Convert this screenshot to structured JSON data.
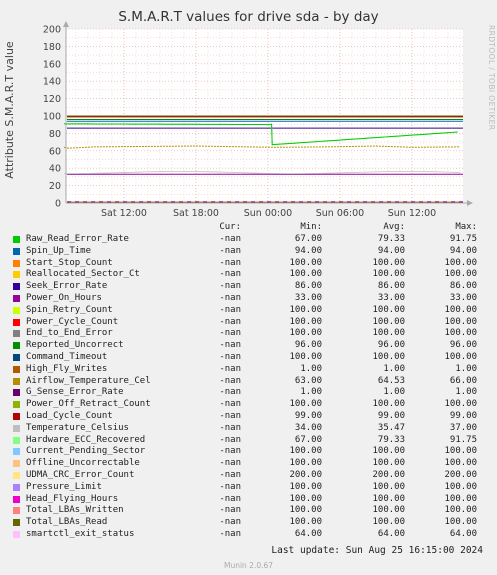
{
  "chart_data": {
    "type": "line",
    "title": "S.M.A.R.T values for drive sda - by day",
    "ylabel": "Attribute S.M.A.R.T value",
    "ylim": [
      0,
      200
    ],
    "yticks": [
      0,
      20,
      40,
      60,
      80,
      100,
      120,
      140,
      160,
      180,
      200
    ],
    "xticks": [
      "Sat 12:00",
      "Sat 18:00",
      "Sun 00:00",
      "Sun 06:00",
      "Sun 12:00"
    ],
    "grid": true,
    "watermark": "RRDTOOL / TOBI OETIKER",
    "columns": [
      "Cur:",
      "Min:",
      "Avg:",
      "Max:"
    ],
    "series": [
      {
        "name": "Raw_Read_Error_Rate",
        "color": "#00cc00",
        "cur": "-nan",
        "min": "67.00",
        "avg": "79.33",
        "max": "91.75"
      },
      {
        "name": "Spin_Up_Time",
        "color": "#0066b3",
        "cur": "-nan",
        "min": "94.00",
        "avg": "94.00",
        "max": "94.00"
      },
      {
        "name": "Start_Stop_Count",
        "color": "#ff8000",
        "cur": "-nan",
        "min": "100.00",
        "avg": "100.00",
        "max": "100.00"
      },
      {
        "name": "Reallocated_Sector_Ct",
        "color": "#ffcc00",
        "cur": "-nan",
        "min": "100.00",
        "avg": "100.00",
        "max": "100.00"
      },
      {
        "name": "Seek_Error_Rate",
        "color": "#330099",
        "cur": "-nan",
        "min": "86.00",
        "avg": "86.00",
        "max": "86.00"
      },
      {
        "name": "Power_On_Hours",
        "color": "#990099",
        "cur": "-nan",
        "min": "33.00",
        "avg": "33.00",
        "max": "33.00"
      },
      {
        "name": "Spin_Retry_Count",
        "color": "#ccff00",
        "cur": "-nan",
        "min": "100.00",
        "avg": "100.00",
        "max": "100.00"
      },
      {
        "name": "Power_Cycle_Count",
        "color": "#ff0000",
        "cur": "-nan",
        "min": "100.00",
        "avg": "100.00",
        "max": "100.00"
      },
      {
        "name": "End_to_End_Error",
        "color": "#808080",
        "cur": "-nan",
        "min": "100.00",
        "avg": "100.00",
        "max": "100.00"
      },
      {
        "name": "Reported_Uncorrect",
        "color": "#008f00",
        "cur": "-nan",
        "min": "96.00",
        "avg": "96.00",
        "max": "96.00"
      },
      {
        "name": "Command_Timeout",
        "color": "#00487d",
        "cur": "-nan",
        "min": "100.00",
        "avg": "100.00",
        "max": "100.00"
      },
      {
        "name": "High_Fly_Writes",
        "color": "#b35a00",
        "cur": "-nan",
        "min": "1.00",
        "avg": "1.00",
        "max": "1.00"
      },
      {
        "name": "Airflow_Temperature_Cel",
        "color": "#b38f00",
        "cur": "-nan",
        "min": "63.00",
        "avg": "64.53",
        "max": "66.00"
      },
      {
        "name": "G_Sense_Error_Rate",
        "color": "#6b006b",
        "cur": "-nan",
        "min": "1.00",
        "avg": "1.00",
        "max": "1.00"
      },
      {
        "name": "Power_Off_Retract_Count",
        "color": "#8fb300",
        "cur": "-nan",
        "min": "100.00",
        "avg": "100.00",
        "max": "100.00"
      },
      {
        "name": "Load_Cycle_Count",
        "color": "#b30000",
        "cur": "-nan",
        "min": "99.00",
        "avg": "99.00",
        "max": "99.00"
      },
      {
        "name": "Temperature_Celsius",
        "color": "#bebebe",
        "cur": "-nan",
        "min": "34.00",
        "avg": "35.47",
        "max": "37.00"
      },
      {
        "name": "Hardware_ECC_Recovered",
        "color": "#80ff80",
        "cur": "-nan",
        "min": "67.00",
        "avg": "79.33",
        "max": "91.75"
      },
      {
        "name": "Current_Pending_Sector",
        "color": "#80c9ff",
        "cur": "-nan",
        "min": "100.00",
        "avg": "100.00",
        "max": "100.00"
      },
      {
        "name": "Offline_Uncorrectable",
        "color": "#ffc080",
        "cur": "-nan",
        "min": "100.00",
        "avg": "100.00",
        "max": "100.00"
      },
      {
        "name": "UDMA_CRC_Error_Count",
        "color": "#ffe680",
        "cur": "-nan",
        "min": "200.00",
        "avg": "200.00",
        "max": "200.00"
      },
      {
        "name": "Pressure_Limit",
        "color": "#aa80ff",
        "cur": "-nan",
        "min": "100.00",
        "avg": "100.00",
        "max": "100.00"
      },
      {
        "name": "Head_Flying_Hours",
        "color": "#ee00cc",
        "cur": "-nan",
        "min": "100.00",
        "avg": "100.00",
        "max": "100.00"
      },
      {
        "name": "Total_LBAs_Written",
        "color": "#ff8080",
        "cur": "-nan",
        "min": "100.00",
        "avg": "100.00",
        "max": "100.00"
      },
      {
        "name": "Total_LBAs_Read",
        "color": "#666600",
        "cur": "-nan",
        "min": "100.00",
        "avg": "100.00",
        "max": "100.00"
      },
      {
        "name": "smartctl_exit_status",
        "color": "#ffbfff",
        "cur": "-nan",
        "min": "64.00",
        "avg": "64.00",
        "max": "64.00"
      }
    ],
    "last_update": "Last update: Sun Aug 25 16:15:00 2024",
    "footer": "Munin 2.0.67"
  }
}
